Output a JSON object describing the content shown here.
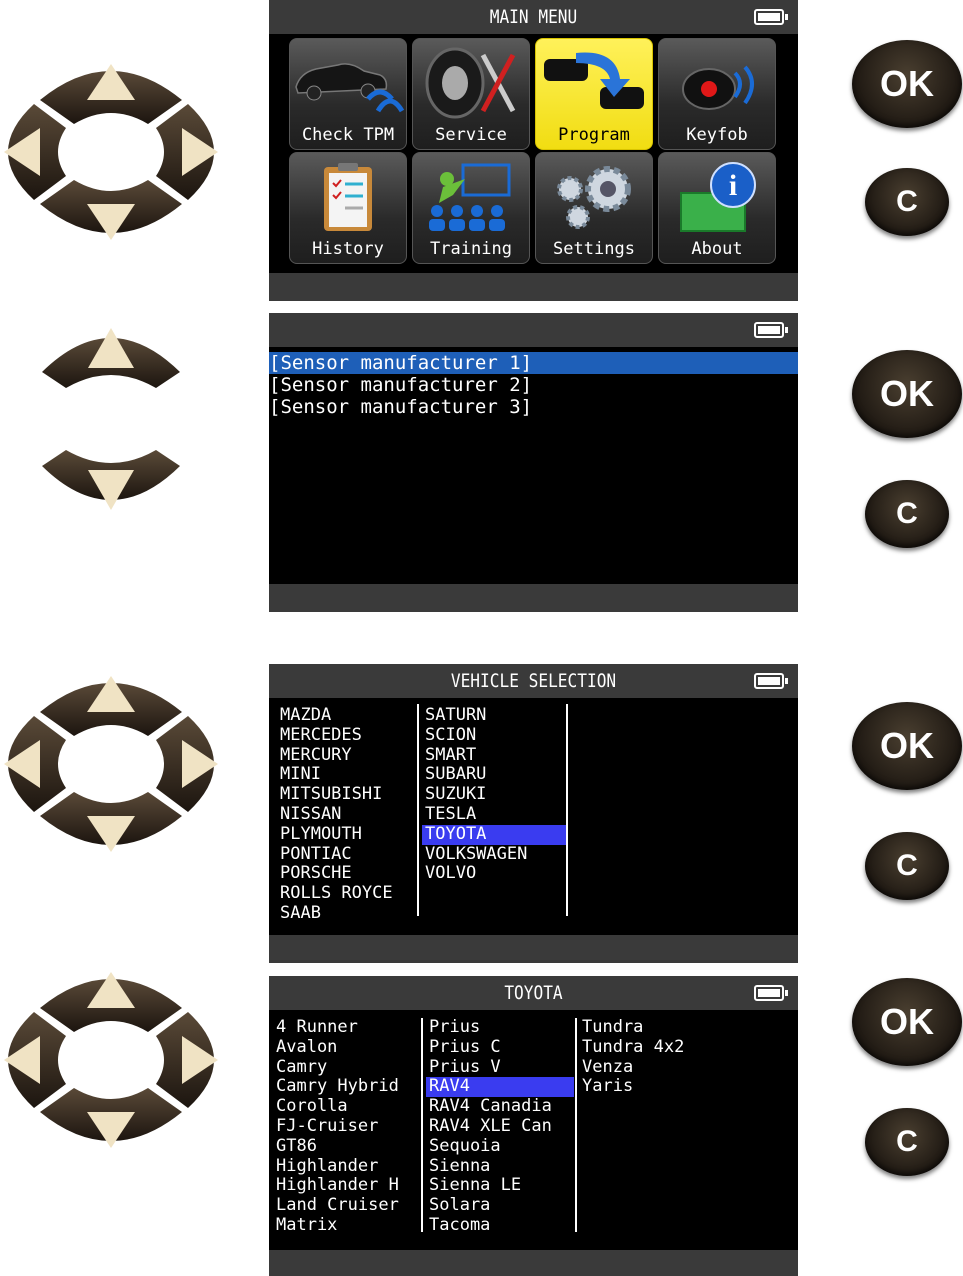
{
  "screen1": {
    "title": "MAIN MENU",
    "tiles": [
      {
        "label": "Check TPM",
        "icon": "car-signal-icon"
      },
      {
        "label": "Service",
        "icon": "tire-tools-icon"
      },
      {
        "label": "Program",
        "icon": "sensor-program-icon"
      },
      {
        "label": "Keyfob",
        "icon": "keyfob-icon"
      },
      {
        "label": "History",
        "icon": "clipboard-icon"
      },
      {
        "label": "Training",
        "icon": "training-icon"
      },
      {
        "label": "Settings",
        "icon": "gears-icon"
      },
      {
        "label": "About",
        "icon": "info-icon"
      }
    ],
    "selected_index": 2
  },
  "screen2": {
    "items": [
      "[Sensor manufacturer 1]",
      "[Sensor manufacturer 2]",
      "[Sensor manufacturer 3]"
    ],
    "selected_index": 0
  },
  "screen3": {
    "title": "VEHICLE SELECTION",
    "col1": [
      "MAZDA",
      "MERCEDES",
      "MERCURY",
      "MINI",
      "MITSUBISHI",
      "NISSAN",
      "PLYMOUTH",
      "PONTIAC",
      "PORSCHE",
      "ROLLS ROYCE",
      "SAAB"
    ],
    "col2": [
      "SATURN",
      "SCION",
      "SMART",
      "SUBARU",
      "SUZUKI",
      "TESLA",
      "TOYOTA",
      "VOLKSWAGEN",
      "VOLVO"
    ],
    "selected": "TOYOTA"
  },
  "screen4": {
    "title": "TOYOTA",
    "col1": [
      "4 Runner",
      "Avalon",
      "Camry",
      "Camry Hybrid",
      "Corolla",
      "FJ-Cruiser",
      "GT86",
      "Highlander",
      "Highlander H",
      "Land Cruiser",
      "Matrix"
    ],
    "col2": [
      "Prius",
      "Prius C",
      "Prius V",
      "RAV4",
      "RAV4 Canadia",
      "RAV4 XLE Can",
      "Sequoia",
      "Sienna",
      "Sienna LE",
      "Solara",
      "Tacoma"
    ],
    "col3": [
      "Tundra",
      "Tundra 4x2",
      "Venza",
      "Yaris"
    ],
    "selected": "RAV4"
  },
  "buttons": {
    "ok_label": "OK",
    "c_label": "C"
  },
  "colors": {
    "selection_blue": "#1e5fb8",
    "list_highlight": "#3a3cf0",
    "selected_tile": "#f4e21a"
  }
}
